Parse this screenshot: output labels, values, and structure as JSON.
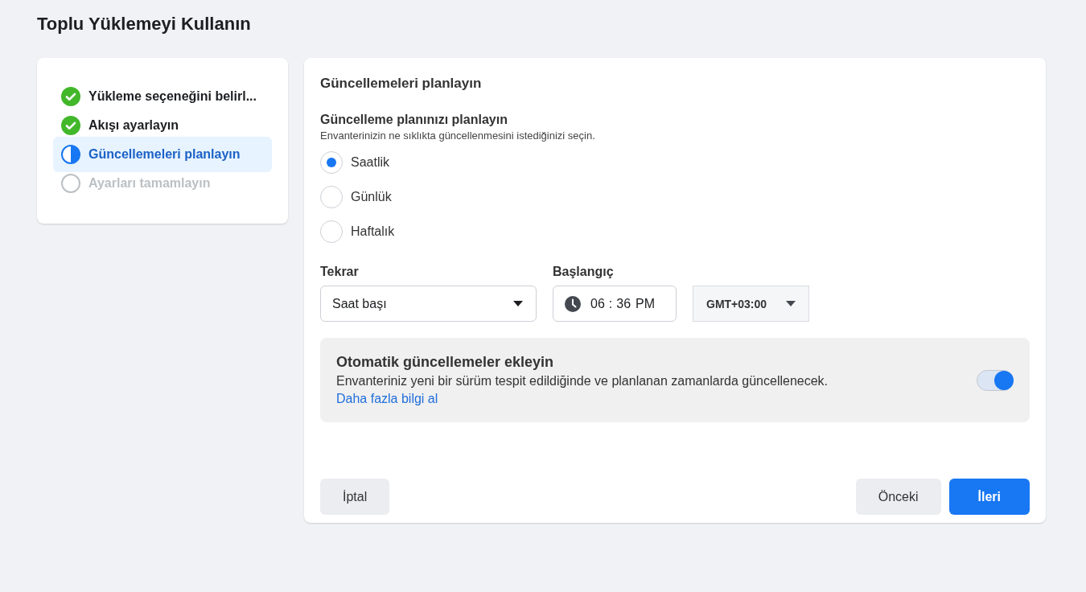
{
  "page_title": "Toplu Yüklemeyi Kullanın",
  "steps": [
    {
      "label": "Yükleme seçeneğini belirl...",
      "kind": "done",
      "selected": false
    },
    {
      "label": "Akışı ayarlayın",
      "kind": "done",
      "selected": false
    },
    {
      "label": "Güncellemeleri planlayın",
      "kind": "current",
      "selected": true
    },
    {
      "label": "Ayarları tamamlayın",
      "kind": "todo",
      "selected": false
    }
  ],
  "panel": {
    "title": "Güncellemeleri planlayın",
    "section_title": "Güncelleme planınızı planlayın",
    "section_hint": "Envanterinizin ne sıklıkta güncellenmesini istediğinizi seçin.",
    "frequency": [
      {
        "label": "Saatlik",
        "selected": true
      },
      {
        "label": "Günlük",
        "selected": false
      },
      {
        "label": "Haftalık",
        "selected": false
      }
    ],
    "repeat": {
      "label": "Tekrar",
      "value": "Saat başı"
    },
    "start": {
      "label": "Başlangıç",
      "hour": "06",
      "separator": ":",
      "minute": "36",
      "ampm": "PM"
    },
    "timezone": {
      "value": "GMT+03:00"
    },
    "auto_updates": {
      "title": "Otomatik güncellemeler ekleyin",
      "description": "Envanteriniz yeni bir sürüm tespit edildiğinde ve planlanan zamanlarda güncellenecek.",
      "link": "Daha fazla bilgi al",
      "on": true
    },
    "buttons": {
      "cancel": "İptal",
      "previous": "Önceki",
      "next": "İleri"
    }
  }
}
